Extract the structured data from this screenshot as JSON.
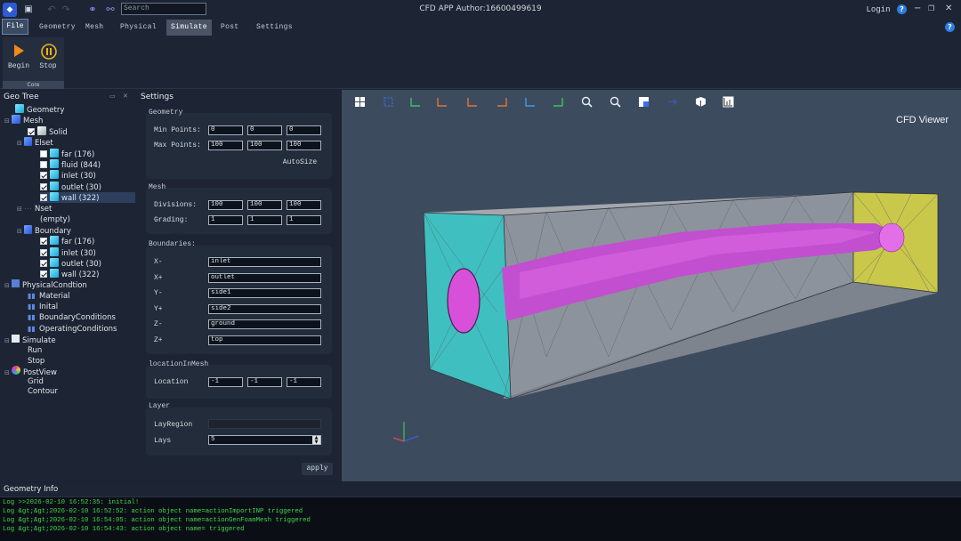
{
  "titlebar": {
    "title": "CFD APP Author:16600499619",
    "search_placeholder": "Search",
    "login": "Login"
  },
  "menu": [
    "File",
    "Geometry",
    "Mesh",
    "Physical",
    "Simulate",
    "Post",
    "Settings"
  ],
  "ribbon": {
    "begin": "Begin",
    "stop": "Stop",
    "group": "Core"
  },
  "geo_tree": {
    "title": "Geo Tree",
    "items": [
      {
        "label": "Geometry"
      },
      {
        "label": "Mesh"
      },
      {
        "label": "Solid"
      },
      {
        "label": "Elset"
      },
      {
        "label": "far (176)"
      },
      {
        "label": "fluid (844)"
      },
      {
        "label": "inlet (30)"
      },
      {
        "label": "outlet (30)"
      },
      {
        "label": "wall (322)"
      },
      {
        "label": "Nset"
      },
      {
        "label": "(empty)"
      },
      {
        "label": "Boundary"
      },
      {
        "label": "far (176)"
      },
      {
        "label": "inlet (30)"
      },
      {
        "label": "outlet (30)"
      },
      {
        "label": "wall (322)"
      },
      {
        "label": "PhysicalCondtion"
      },
      {
        "label": "Material"
      },
      {
        "label": "Inital"
      },
      {
        "label": "BoundaryConditions"
      },
      {
        "label": "OperatingConditions"
      },
      {
        "label": "Simulate"
      },
      {
        "label": "Run"
      },
      {
        "label": "Stop"
      },
      {
        "label": "PostView"
      },
      {
        "label": "Grid"
      },
      {
        "label": "Contour"
      }
    ]
  },
  "settings": {
    "title": "Settings",
    "geometry": {
      "title": "Geometry",
      "min_label": "Min Points:",
      "min": [
        "0",
        "0",
        "0"
      ],
      "max_label": "Max Points:",
      "max": [
        "100",
        "100",
        "100"
      ],
      "autosize": "AutoSize"
    },
    "mesh": {
      "title": "Mesh",
      "div_label": "Divisions:",
      "div": [
        "100",
        "100",
        "100"
      ],
      "grad_label": "Grading:",
      "grad": [
        "1",
        "1",
        "1"
      ]
    },
    "boundaries": {
      "title": "Boundaries:",
      "rows": [
        {
          "label": "X-",
          "value": "inlet"
        },
        {
          "label": "X+",
          "value": "outlet"
        },
        {
          "label": "Y-",
          "value": "side1"
        },
        {
          "label": "Y+",
          "value": "side2"
        },
        {
          "label": "Z-",
          "value": "ground"
        },
        {
          "label": "Z+",
          "value": "top"
        }
      ]
    },
    "location": {
      "title": "locationInMesh",
      "label": "Location",
      "values": [
        "-1",
        "-1",
        "-1"
      ]
    },
    "layer": {
      "title": "Layer",
      "region_label": "LayRegion",
      "region_value": "",
      "lays_label": "Lays",
      "lays_value": "5"
    },
    "apply": "apply"
  },
  "viewer": {
    "title": "CFD Viewer"
  },
  "info": {
    "title": "Geometry Info"
  },
  "log": [
    "Log >>2026-02-10 16:52:35: initial!",
    "Log &gt;&gt;2026-02-10 16:52:52:  action object name=actionImportINP triggered",
    "Log &gt;&gt;2026-02-10 16:54:05:  action object name=actionGenFoamMesh triggered",
    "Log &gt;&gt;2026-02-10 16:54:43:  action object name= triggered"
  ]
}
